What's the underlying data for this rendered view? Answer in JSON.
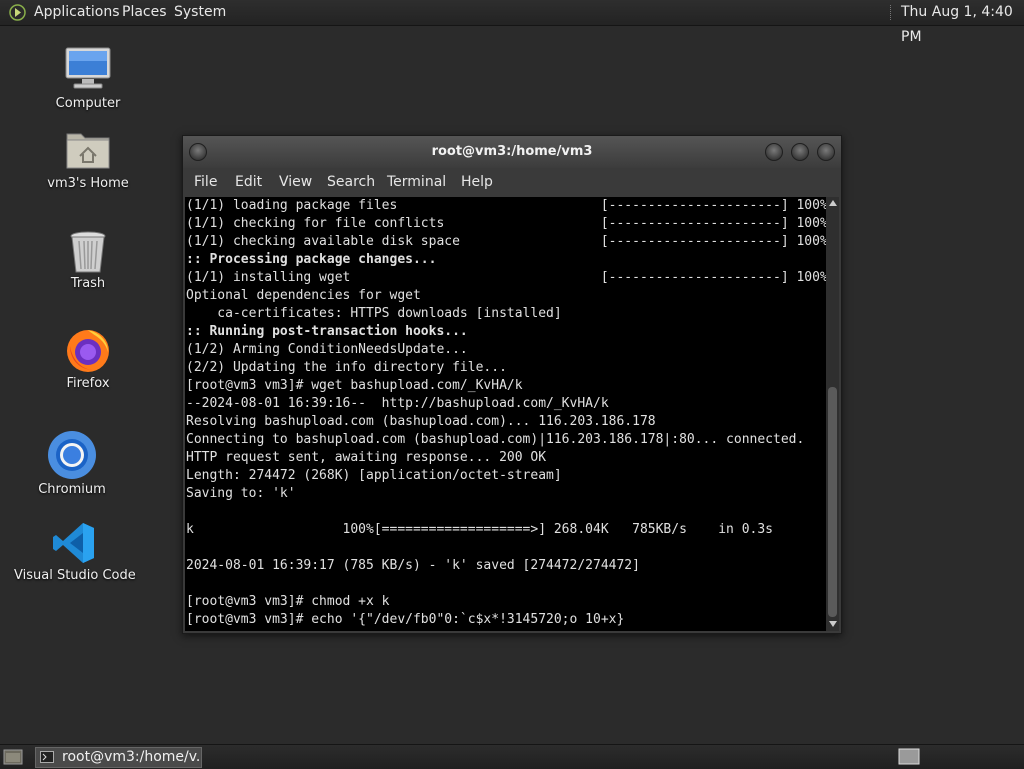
{
  "top_panel": {
    "menus": [
      "Applications",
      "Places",
      "System"
    ],
    "clock": "Thu Aug  1,  4:40 PM"
  },
  "desktop": {
    "icons": [
      {
        "label": "Computer",
        "icon": "computer-icon"
      },
      {
        "label": "vm3's Home",
        "icon": "home-folder-icon"
      },
      {
        "label": "Trash",
        "icon": "trash-icon"
      },
      {
        "label": "Firefox",
        "icon": "firefox-icon"
      },
      {
        "label": "Chromium",
        "icon": "chromium-icon"
      },
      {
        "label": "Visual Studio Code",
        "icon": "vscode-icon"
      }
    ]
  },
  "terminal": {
    "title": "root@vm3:/home/vm3",
    "menu": [
      "File",
      "Edit",
      "View",
      "Search",
      "Terminal",
      "Help"
    ],
    "lines": [
      {
        "text": "(1/1) loading package files                          [----------------------] 100%"
      },
      {
        "text": "(1/1) checking for file conflicts                    [----------------------] 100%"
      },
      {
        "text": "(1/1) checking available disk space                  [----------------------] 100%"
      },
      {
        "text": ":: Processing package changes...",
        "bold": true
      },
      {
        "text": "(1/1) installing wget                                [----------------------] 100%"
      },
      {
        "text": "Optional dependencies for wget"
      },
      {
        "text": "    ca-certificates: HTTPS downloads [installed]"
      },
      {
        "text": ":: Running post-transaction hooks...",
        "bold": true
      },
      {
        "text": "(1/2) Arming ConditionNeedsUpdate..."
      },
      {
        "text": "(2/2) Updating the info directory file..."
      },
      {
        "text": "[root@vm3 vm3]# wget bashupload.com/_KvHA/k"
      },
      {
        "text": "--2024-08-01 16:39:16--  http://bashupload.com/_KvHA/k"
      },
      {
        "text": "Resolving bashupload.com (bashupload.com)... 116.203.186.178"
      },
      {
        "text": "Connecting to bashupload.com (bashupload.com)|116.203.186.178|:80... connected."
      },
      {
        "text": "HTTP request sent, awaiting response... 200 OK"
      },
      {
        "text": "Length: 274472 (268K) [application/octet-stream]"
      },
      {
        "text": "Saving to: 'k'"
      },
      {
        "text": ""
      },
      {
        "text": "k                   100%[===================>] 268.04K   785KB/s    in 0.3s"
      },
      {
        "text": ""
      },
      {
        "text": "2024-08-01 16:39:17 (785 KB/s) - 'k' saved [274472/274472]"
      },
      {
        "text": ""
      },
      {
        "text": "[root@vm3 vm3]# chmod +x k"
      },
      {
        "text": "[root@vm3 vm3]# echo '{\"/dev/fb0\"0:`c$x*!3145720;o 10+x}"
      }
    ]
  },
  "taskbar": {
    "window_button": "root@vm3:/home/v..."
  }
}
